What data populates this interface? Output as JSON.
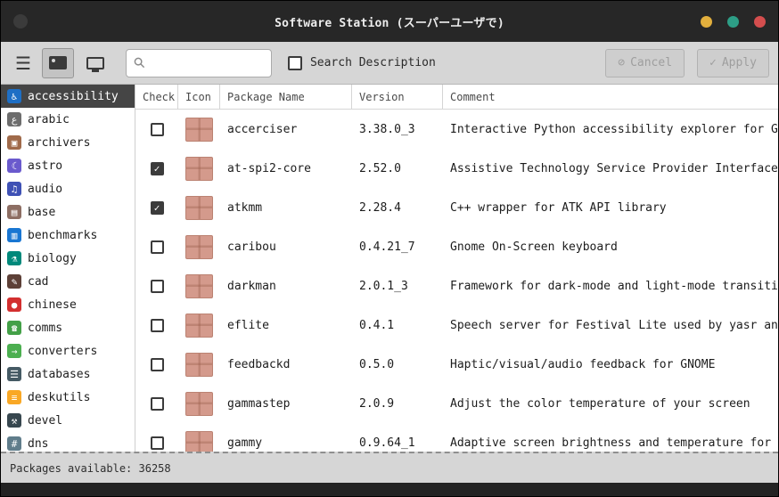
{
  "window": {
    "title": "Software Station (スーパーユーザで)",
    "traffic_lights": [
      {
        "name": "minimize-button",
        "color": "#e2af3d"
      },
      {
        "name": "maximize-button",
        "color": "#2d9e86"
      },
      {
        "name": "close-button",
        "color": "#d44e4e"
      }
    ]
  },
  "toolbar": {
    "search_placeholder": "",
    "search_value": "",
    "search_description_label": "Search Description",
    "cancel_label": "Cancel",
    "cancel_icon_glyph": "⊘",
    "apply_label": "Apply",
    "apply_icon_glyph": "✓"
  },
  "sidebar": {
    "items": [
      {
        "label": "accessibility",
        "selected": true,
        "icon": "accessibility-icon",
        "glyph": "♿",
        "color": "#1e6fc5"
      },
      {
        "label": "arabic",
        "selected": false,
        "icon": "arabic-icon",
        "glyph": "ع",
        "color": "#6d6d6d"
      },
      {
        "label": "archivers",
        "selected": false,
        "icon": "archivers-icon",
        "glyph": "▣",
        "color": "#a06a4a"
      },
      {
        "label": "astro",
        "selected": false,
        "icon": "astro-icon",
        "glyph": "☾",
        "color": "#6a5acd"
      },
      {
        "label": "audio",
        "selected": false,
        "icon": "audio-icon",
        "glyph": "♫",
        "color": "#3f51b5"
      },
      {
        "label": "base",
        "selected": false,
        "icon": "base-icon",
        "glyph": "▤",
        "color": "#8d6e63"
      },
      {
        "label": "benchmarks",
        "selected": false,
        "icon": "benchmarks-icon",
        "glyph": "▥",
        "color": "#1976d2"
      },
      {
        "label": "biology",
        "selected": false,
        "icon": "biology-icon",
        "glyph": "⚗",
        "color": "#00897b"
      },
      {
        "label": "cad",
        "selected": false,
        "icon": "cad-icon",
        "glyph": "✎",
        "color": "#5d4037"
      },
      {
        "label": "chinese",
        "selected": false,
        "icon": "chinese-icon",
        "glyph": "●",
        "color": "#d32f2f"
      },
      {
        "label": "comms",
        "selected": false,
        "icon": "comms-icon",
        "glyph": "☎",
        "color": "#43a047"
      },
      {
        "label": "converters",
        "selected": false,
        "icon": "converters-icon",
        "glyph": "→",
        "color": "#4caf50"
      },
      {
        "label": "databases",
        "selected": false,
        "icon": "databases-icon",
        "glyph": "☰",
        "color": "#455a64"
      },
      {
        "label": "deskutils",
        "selected": false,
        "icon": "deskutils-icon",
        "glyph": "≡",
        "color": "#f9a825"
      },
      {
        "label": "devel",
        "selected": false,
        "icon": "devel-icon",
        "glyph": "⚒",
        "color": "#37474f"
      },
      {
        "label": "dns",
        "selected": false,
        "icon": "dns-icon",
        "glyph": "#",
        "color": "#607d8b"
      }
    ]
  },
  "table": {
    "columns": [
      "Check",
      "Icon",
      "Package Name",
      "Version",
      "Comment"
    ],
    "rows": [
      {
        "checked": false,
        "name": "accerciser",
        "version": "3.38.0_3",
        "comment": "Interactive Python accessibility explorer for GNOME"
      },
      {
        "checked": true,
        "name": "at-spi2-core",
        "version": "2.52.0",
        "comment": "Assistive Technology Service Provider Interface"
      },
      {
        "checked": true,
        "name": "atkmm",
        "version": "2.28.4",
        "comment": "C++ wrapper for ATK API library"
      },
      {
        "checked": false,
        "name": "caribou",
        "version": "0.4.21_7",
        "comment": "Gnome On-Screen keyboard"
      },
      {
        "checked": false,
        "name": "darkman",
        "version": "2.0.1_3",
        "comment": "Framework for dark-mode and light-mode transitions"
      },
      {
        "checked": false,
        "name": "eflite",
        "version": "0.4.1",
        "comment": "Speech server for Festival Lite used by yasr and Ema"
      },
      {
        "checked": false,
        "name": "feedbackd",
        "version": "0.5.0",
        "comment": "Haptic/visual/audio feedback for GNOME"
      },
      {
        "checked": false,
        "name": "gammastep",
        "version": "2.0.9",
        "comment": "Adjust the color temperature of your screen"
      },
      {
        "checked": false,
        "name": "gammy",
        "version": "0.9.64_1",
        "comment": "Adaptive screen brightness and temperature for Windo"
      }
    ]
  },
  "statusbar": {
    "text": "Packages available: 36258"
  }
}
